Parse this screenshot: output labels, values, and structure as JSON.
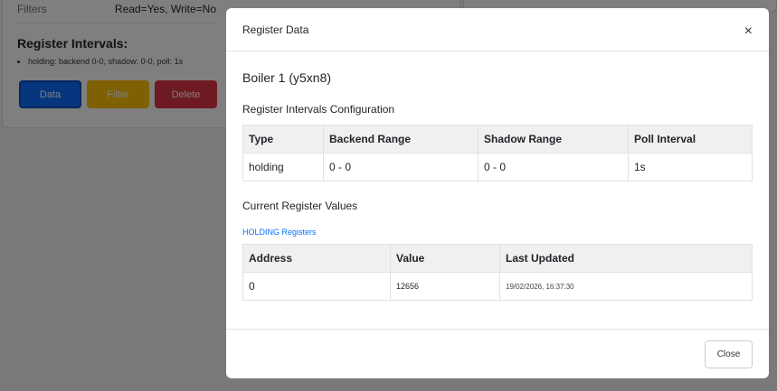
{
  "background": {
    "filters": {
      "label": "Filters",
      "value": "Read=Yes, Write=No"
    },
    "register_intervals_heading": "Register Intervals:",
    "intervals": [
      "holding: backend 0-0, shadow: 0-0, poll: 1s"
    ],
    "buttons": {
      "data": "Data",
      "filter": "Filter",
      "delete": "Delete"
    }
  },
  "modal": {
    "title": "Register Data",
    "close_icon": "×",
    "device_name": "Boiler 1 (y5xn8)",
    "config_heading": "Register Intervals Configuration",
    "config_table": {
      "headers": [
        "Type",
        "Backend Range",
        "Shadow Range",
        "Poll Interval"
      ],
      "rows": [
        [
          "holding",
          "0 - 0",
          "0 - 0",
          "1s"
        ]
      ]
    },
    "values_heading": "Current Register Values",
    "holding_heading": "HOLDING Registers",
    "values_table": {
      "headers": [
        "Address",
        "Value",
        "Last Updated"
      ],
      "rows": [
        [
          "0",
          "12656",
          "19/02/2026, 16:37:30"
        ]
      ]
    },
    "close_button": "Close"
  },
  "colors": {
    "primary": "#0d6efd",
    "warning": "#ffc107",
    "danger": "#dc3545"
  }
}
